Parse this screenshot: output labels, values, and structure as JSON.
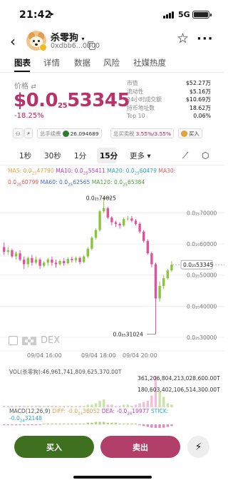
{
  "status_bar": {
    "time": "21:42",
    "network": "5G"
  },
  "token": {
    "name": "杀零狗",
    "address": "0xdbb6...0000"
  },
  "tabs": [
    "图表",
    "详情",
    "数据",
    "风险",
    "社媒热度"
  ],
  "price_block": {
    "label": "价格",
    "price_prefix": "$0.0",
    "price_zeros": "25",
    "price_digits": "53345",
    "change": "-18.25%"
  },
  "stats": [
    {
      "k": "市值",
      "v": "$52.27万"
    },
    {
      "k": "流动性",
      "v": "$5.16万"
    },
    {
      "k": "24小时成交额",
      "v": "$10.69万"
    },
    {
      "k": "持币地址数",
      "v": "18.62万"
    },
    {
      "k": "Top 10",
      "v": "0.06%"
    }
  ],
  "fee_bar": {
    "fee_label": "总手续费",
    "fee_value": "26.094689",
    "tax_label": "总买卖税",
    "tax_value": "3.55%/3.55%",
    "buy_label": "买入"
  },
  "timeframes": [
    "1秒",
    "30秒",
    "1分",
    "15分",
    "更多"
  ],
  "ma": {
    "ma5": "MA5: 0.0",
    "ma5_sub": "25",
    "ma5_val": "47790",
    "ma10": "MA10: 0.0",
    "ma10_sub": "25",
    "ma10_val": "55411",
    "ma20": "MA20: 0.0",
    "ma20_sub": "25",
    "ma20_val": "60479",
    "ma30": "MA30:",
    "ma30b": "0.0",
    "ma30_sub": "25",
    "ma30_val": "60799",
    "ma60": "MA60: 0.0",
    "ma60_sub": "25",
    "ma60_val": "62565",
    "ma120": "MA120: 0.0",
    "ma120_sub": "25",
    "ma120_val": "65384"
  },
  "chart_labels": {
    "high": "0.0",
    "high_sub": "25",
    "high_val": "74825",
    "low": "0.0",
    "low_sub": "25",
    "low_val": "31024",
    "current": "0.0",
    "current_sub": "25",
    "current_val": "53345",
    "dex": "DEX"
  },
  "x_labels": [
    "09/04 16:00",
    "09/04 18:00",
    "09/04 20:00"
  ],
  "volume": {
    "title": "VOL(杀零狗):46,961,741,809,625,370.00T",
    "label1": "361,206,804,213,028,600.00T",
    "label2": "180,603,402,106,514,300.00T"
  },
  "macd": {
    "title": "MACD(12,26,9)",
    "diff": "DIFF: -0.0",
    "diff_sub": "24",
    "diff_val": "36052",
    "dea": "DEA: -0.0",
    "dea_sub": "24",
    "dea_val": "19977",
    "stick": "STICK:",
    "stick2": "-0.0",
    "stick2_sub": "24",
    "stick2_val": "32148"
  },
  "actions": {
    "buy": "买入",
    "sell": "卖出"
  },
  "colors": {
    "up": "#8ac43f",
    "down": "#e0529c",
    "price": "#b8336a"
  },
  "chart_data": {
    "type": "candlestick",
    "y_ticks": [
      "0.0₂₅70000",
      "0.0₂₅60000",
      "0.0₂₅50000",
      "0.0₂₅40000",
      "0.0₂₅30000"
    ],
    "y_values": [
      70000,
      60000,
      50000,
      40000,
      30000
    ],
    "ylim": [
      27000,
      77000
    ],
    "high": 74825,
    "low": 31024,
    "current": 53345,
    "candles": [
      [
        59000,
        57500,
        60500,
        56500
      ],
      [
        57500,
        58000,
        59000,
        56500
      ],
      [
        58000,
        56000,
        58500,
        55500
      ],
      [
        56000,
        57000,
        57500,
        55000
      ],
      [
        57000,
        55000,
        58000,
        54500
      ],
      [
        55000,
        53500,
        56000,
        52000
      ],
      [
        53500,
        55500,
        56000,
        52500
      ],
      [
        55500,
        54000,
        56500,
        53000
      ],
      [
        54000,
        55000,
        56000,
        53500
      ],
      [
        55000,
        53000,
        55500,
        52000
      ],
      [
        53000,
        54000,
        54500,
        52500
      ],
      [
        54000,
        55000,
        55500,
        53000
      ],
      [
        55000,
        54000,
        56000,
        53000
      ],
      [
        54000,
        53500,
        55000,
        52500
      ],
      [
        53500,
        54500,
        55000,
        53000
      ],
      [
        54500,
        53800,
        55500,
        53000
      ],
      [
        53800,
        55200,
        55800,
        53500
      ],
      [
        55200,
        54800,
        56000,
        54000
      ],
      [
        54800,
        55500,
        56000,
        54000
      ],
      [
        55500,
        54200,
        56000,
        53500
      ],
      [
        54200,
        56000,
        56500,
        53800
      ],
      [
        56000,
        58500,
        59000,
        55500
      ],
      [
        58500,
        62000,
        62500,
        58000
      ],
      [
        62000,
        64500,
        65000,
        61500
      ],
      [
        64500,
        70500,
        71000,
        64000
      ],
      [
        70500,
        71500,
        74825,
        70000
      ],
      [
        71500,
        68500,
        72000,
        68000
      ],
      [
        68500,
        67000,
        69000,
        66000
      ],
      [
        67000,
        66500,
        67500,
        65500
      ],
      [
        66500,
        66000,
        67000,
        65000
      ],
      [
        66000,
        68000,
        68500,
        65500
      ],
      [
        68000,
        68200,
        69000,
        67500
      ],
      [
        68200,
        67500,
        69000,
        67000
      ],
      [
        67500,
        66500,
        68000,
        66000
      ],
      [
        66500,
        64000,
        67000,
        63500
      ],
      [
        64000,
        61000,
        64500,
        60500
      ],
      [
        61000,
        57000,
        61500,
        56500
      ],
      [
        57000,
        53500,
        57500,
        52500
      ],
      [
        53500,
        42500,
        54000,
        31024
      ],
      [
        42500,
        46500,
        48000,
        41500
      ],
      [
        46500,
        49000,
        50000,
        45500
      ],
      [
        49000,
        51500,
        52000,
        48500
      ],
      [
        51500,
        53345,
        54500,
        51000
      ]
    ],
    "volumes": [
      1,
      1,
      1,
      1,
      1,
      1,
      1,
      1,
      1,
      1,
      1,
      1,
      1,
      1,
      1,
      1,
      1,
      1,
      1,
      1,
      1,
      2,
      2,
      3,
      5,
      6,
      2,
      2,
      1,
      1,
      2,
      2,
      1,
      2,
      3,
      4,
      5,
      9,
      24,
      12,
      8,
      3,
      2
    ],
    "macd": [
      -1,
      -1,
      -1,
      -1,
      -1,
      -1,
      -1,
      -1,
      -1,
      -1,
      1,
      1,
      1,
      1,
      1,
      1,
      1,
      1,
      1,
      1,
      1,
      2,
      2,
      3,
      3,
      3,
      2,
      2,
      2,
      1,
      1,
      1,
      1,
      1,
      -1,
      -2,
      -3,
      -4,
      -6,
      -5,
      -4,
      -3,
      -2
    ]
  }
}
